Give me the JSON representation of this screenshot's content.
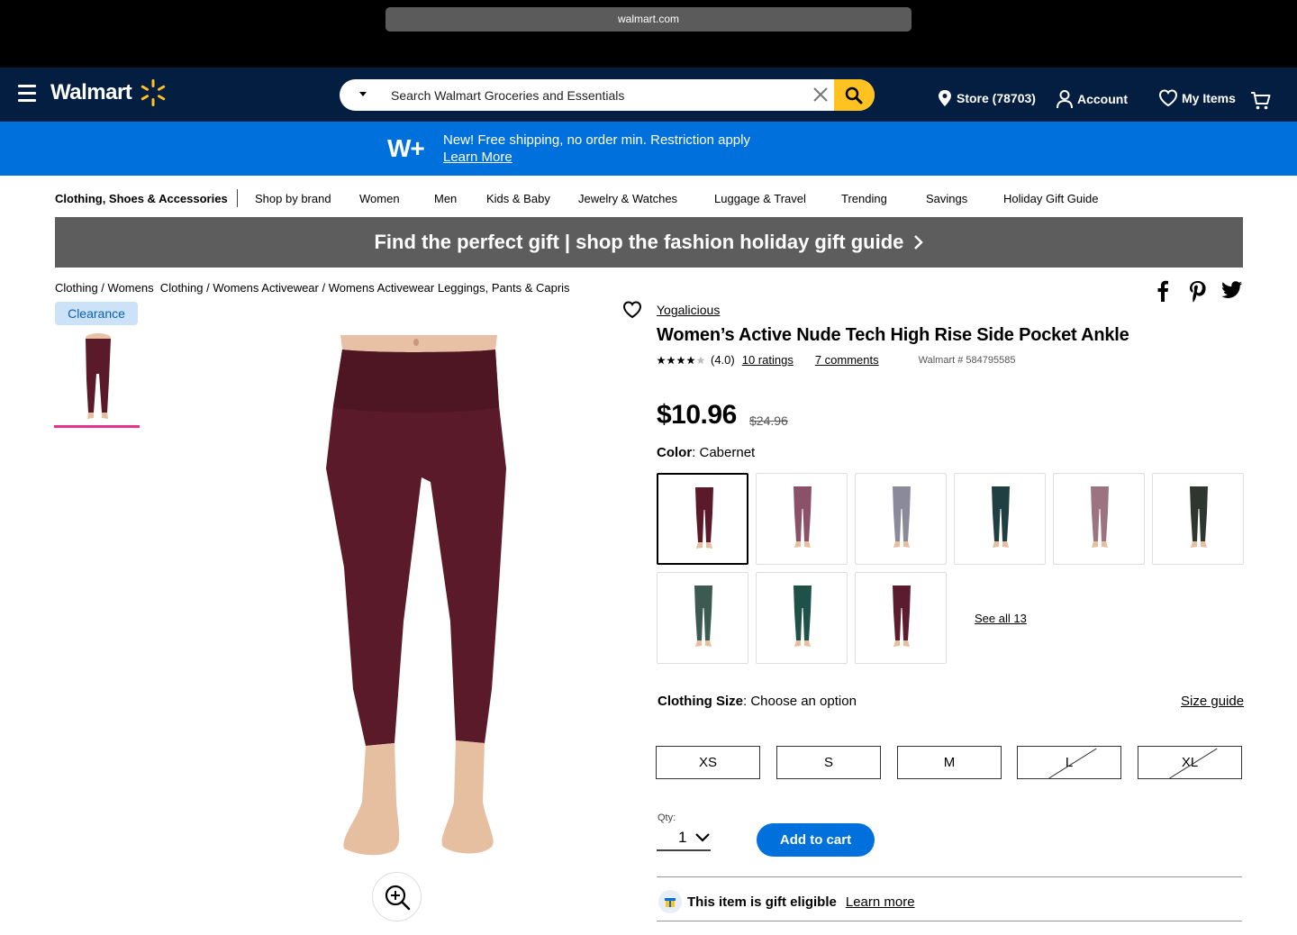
{
  "browser": {
    "url": "walmart.com"
  },
  "header": {
    "logo": "Walmart",
    "search_placeholder": "Search Walmart Groceries and Essentials",
    "store": "Store (78703)",
    "account": "Account",
    "my_items": "My Items"
  },
  "promo": {
    "badge": "W+",
    "message": "New! Free shipping, no order min. Restriction apply",
    "link": "Learn More"
  },
  "nav": {
    "items": [
      "Clothing, Shoes & Accessories",
      "Shop by brand",
      "Women",
      "Men",
      "Kids & Baby",
      "Jewelry & Watches",
      "Luggage & Travel",
      "Trending",
      "Savings",
      "Holiday Gift Guide"
    ]
  },
  "gift_banner": "Find the perfect gift | shop the fashion holiday gift guide",
  "breadcrumb": "Clothing / Womens  Clothing / Womens Activewear / Womens Activewear Leggings, Pants & Capris",
  "badge": "Clearance",
  "product": {
    "brand": "Yogalicious",
    "title": "Women’s Active Nude Tech High Rise Side Pocket Ankle",
    "rating": 4.0,
    "rating_text": "(4.0)",
    "ratings_count": "10  ratings",
    "comments": "7 comments",
    "sku": "Walmart # 584795585",
    "price": "$10.96",
    "was_price": "$24.96",
    "color_label": "Color",
    "color_value": ": Cabernet",
    "swatch_colors": [
      "#5a1a2a",
      "#8a5168",
      "#8a8a9a",
      "#1f3f42",
      "#9c7381",
      "#2f3630",
      "#3c5a52",
      "#1e5248",
      "#5c1c30"
    ],
    "see_all": "See all 13",
    "size_label": "Clothing Size",
    "size_value": ": Choose an option",
    "size_guide": "Size guide",
    "sizes": [
      "XS",
      "S",
      "M",
      "L",
      "XL"
    ],
    "qty_label": "Qty:",
    "qty_value": "1",
    "add_to_cart": "Add to cart",
    "gift_eligible": "This item is gift eligible",
    "gift_learn": "Learn more"
  },
  "colors": {
    "header_bg": "#041e42",
    "promo_bg": "#0071dc",
    "spark": "#ffc220",
    "accent_pink": "#e8318f"
  }
}
